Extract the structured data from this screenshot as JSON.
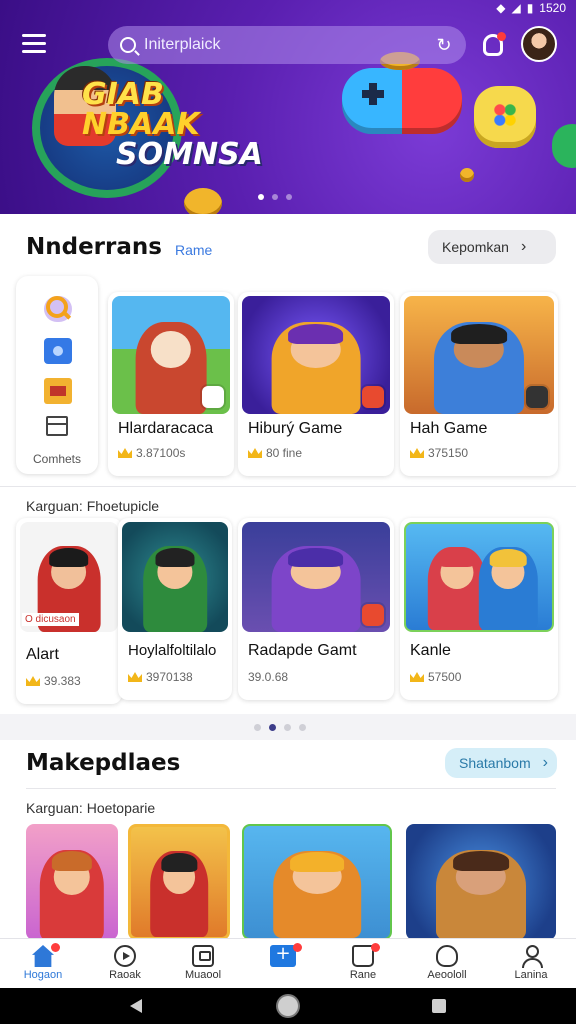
{
  "status_bar": {
    "time": "1520"
  },
  "header": {
    "search_placeholder": "Initerplaick",
    "hero_title_lines": [
      "GIAB",
      "NBAAK",
      "SOMNSA"
    ]
  },
  "section_featured": {
    "title": "Nnderrans",
    "link": "Rame",
    "action_label": "Kepomkan",
    "quick_panel_label": "Comhets",
    "row1": [
      {
        "name": "Hlardaracaca",
        "rating": "3.87100s",
        "theme": "green"
      },
      {
        "name": "Hiburý Game",
        "rating": "80 fine",
        "theme": "purple"
      },
      {
        "name": "Hah Game",
        "rating": "375150",
        "theme": "orange"
      }
    ],
    "row2_label": "Karguan: Fhoetupicle",
    "row2": [
      {
        "name": "Alart",
        "rating": "39.383",
        "promo": "O dicusaon",
        "theme": "white"
      },
      {
        "name": "Hoylalfoltilalo",
        "rating": "3970138",
        "theme": "teal"
      },
      {
        "name": "Radapde Gamt",
        "rating": "39.0.68",
        "theme": "indigo"
      },
      {
        "name": "Kanle",
        "rating": "57500",
        "theme": "blue"
      }
    ]
  },
  "section_market": {
    "title": "Makepdlaes",
    "action_label": "Shatanbom",
    "row_label": "Karguan: Hoetoparie"
  },
  "bottom_nav": [
    {
      "label": "Hogaon",
      "icon": "home-icon",
      "active": true,
      "badge": true
    },
    {
      "label": "Raoak",
      "icon": "play-icon",
      "active": false,
      "badge": false
    },
    {
      "label": "Muaool",
      "icon": "box-icon",
      "active": false,
      "badge": false
    },
    {
      "label": "",
      "icon": "plus-icon",
      "active": false,
      "badge": true
    },
    {
      "label": "Rane",
      "icon": "bag-icon",
      "active": false,
      "badge": true
    },
    {
      "label": "Aeoololl",
      "icon": "gamepad-icon",
      "active": false,
      "badge": false
    },
    {
      "label": "Lanina",
      "icon": "user-icon",
      "active": false,
      "badge": false
    }
  ],
  "colors": {
    "accent": "#2e78d8",
    "hero_purple": "#5a1fb0",
    "badge_red": "#ff3d3d"
  }
}
